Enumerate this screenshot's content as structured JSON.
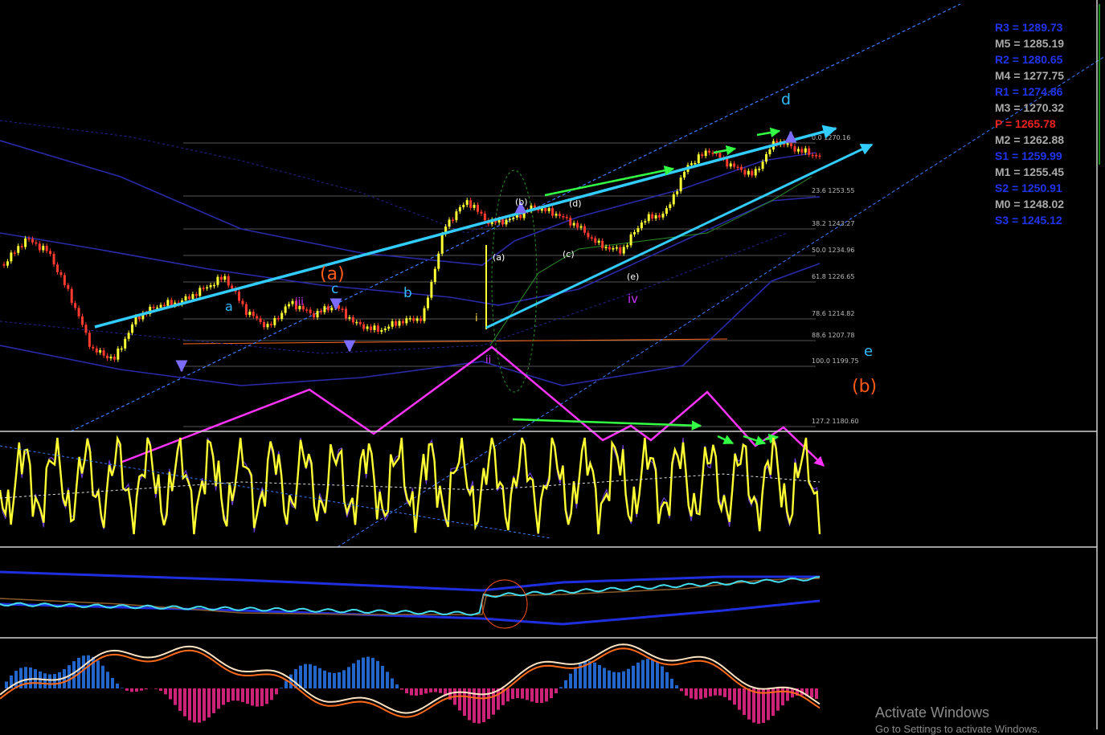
{
  "colors": {
    "background": "#000000",
    "channel": "#33ccff",
    "projection": "#ff33ff",
    "trend_arrow": "#33ff44",
    "oscillator": "#ffff33",
    "histogram_pos": "#2266cc",
    "histogram_neg": "#cc2277",
    "pivot_blue": "#2233ee",
    "pivot_grey": "#aaaaaa",
    "pivot_red": "#ee2222"
  },
  "pivots": [
    {
      "label": "R3 = 1289.73",
      "color": "#2233ee"
    },
    {
      "label": "M5 = 1285.19",
      "color": "#aaaaaa"
    },
    {
      "label": "R2 = 1280.65",
      "color": "#2233ee"
    },
    {
      "label": "M4 = 1277.75",
      "color": "#aaaaaa"
    },
    {
      "label": "R1 = 1274.86",
      "color": "#2233ee"
    },
    {
      "label": "M3 = 1270.32",
      "color": "#aaaaaa"
    },
    {
      "label": "P  = 1265.78",
      "color": "#ee2222"
    },
    {
      "label": "M2 = 1262.88",
      "color": "#aaaaaa"
    },
    {
      "label": "S1 = 1259.99",
      "color": "#2233ee"
    },
    {
      "label": "M1 = 1255.45",
      "color": "#aaaaaa"
    },
    {
      "label": "S2 = 1250.91",
      "color": "#2233ee"
    },
    {
      "label": "M0 = 1248.02",
      "color": "#aaaaaa"
    },
    {
      "label": "S3 = 1245.12",
      "color": "#2233ee"
    }
  ],
  "chart_data": {
    "type": "line",
    "fib_levels": [
      "0.0 1270.16",
      "23.6 1253.55",
      "38.2 1243.27",
      "50.0 1234.96",
      "61.8 1226.65",
      "78.6 1214.82",
      "88.6 1207.78",
      "100.0 1199.75",
      "127.2 1180.60"
    ],
    "wave_labels": [
      "(a)",
      "(b)",
      "d",
      "e",
      "c",
      "b",
      "a",
      "iv",
      "ii",
      "iii",
      "i",
      "(b)",
      "(d)",
      "(c)",
      "(a)",
      "(e)"
    ],
    "price_path": [
      1232,
      1240,
      1236,
      1222,
      1205,
      1202,
      1215,
      1219,
      1220,
      1224,
      1228,
      1217,
      1212,
      1220,
      1216,
      1219,
      1213,
      1211,
      1214,
      1215,
      1244,
      1252,
      1245,
      1246,
      1250,
      1248,
      1244,
      1238,
      1236,
      1246,
      1248,
      1263,
      1268,
      1263,
      1260,
      1271,
      1268,
      1266
    ]
  },
  "watermark": {
    "title": "Activate Windows",
    "subtitle": "Go to Settings to activate Windows."
  }
}
